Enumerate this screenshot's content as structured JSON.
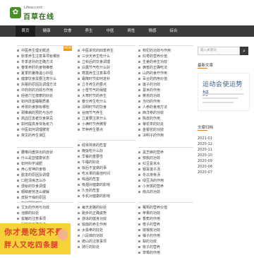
{
  "header": {
    "logo_icon": "✿",
    "logo_sub": "Lifeaccord",
    "logo_title": "百草在线"
  },
  "nav": {
    "items": [
      "首页",
      "健康",
      "饮食",
      "养生",
      "中医",
      "两性",
      "情感",
      "综合"
    ],
    "active_index": 0
  },
  "search": {
    "placeholder": "输入关键词",
    "button_icon": "search-icon"
  },
  "sidebar": {
    "section_title": "最新文章",
    "ad_text": "运动会使运势好",
    "archive_title": "文章归档",
    "archive": [
      "2021-01",
      "2020-12",
      "2020-11",
      "2020-10",
      "2020-09",
      "2020-08",
      "2020-07"
    ]
  },
  "col1": {
    "tag": "NEW",
    "items": [
      "中医养生理论概述",
      "秋季养生注意事项有哪些",
      "冬季进补的正确方法",
      "春季养肝的食物推荐",
      "夏季防暑降温小妙招",
      "健康饮食需要注意什么",
      "失眠的原因及调理方法",
      "中药材的功效与作用",
      "经络穴位按摩的好处",
      "如何改善睡眠质量",
      "养胃的食物有哪些",
      "颈椎病的预防与治疗",
      "高血压患者饮食禁忌",
      "如何提高身体免疫力",
      "中医如何调理脾胃",
      "常见的养生误区",
      "补肾的食物有哪些",
      "茶叶的保健功效",
      "喝水的正确时间",
      "运动养生的好处",
      "老年人养生保健",
      "女性养颜的方法",
      "儿童饮食健康"
    ],
    "items2": [
      "腰椎间盘突出的症状",
      "什么是亚健康状态",
      "如何科学减肥",
      "养心安神的食物",
      "脱发的原因及调理",
      "口腔溃疡怎么办",
      "便秘的饮食调理",
      "眼睛疲劳怎么缓解",
      "皮肤干燥的原因",
      "如何预防感冒"
    ],
    "items3": [
      "艾灸的作用与功效",
      "泡脚的好处",
      "拔罐的注意事项",
      "刮痧的正确方法"
    ]
  },
  "col2": {
    "items": [
      "中医讲究的四季养生",
      "三伏天养生吃什么",
      "立秋后的饮食调理",
      "白露节气吃什么好",
      "寒露养生注意事项",
      "霜降时节如何进补",
      "立冬养生的要点",
      "小雪节气的保健",
      "大寒时节的养生",
      "春分养生吃什么",
      "清明时节的饮食",
      "谷雨节气养生",
      "立夏要注意什么",
      "小满时节养脾胃",
      "芒种养生要点",
      "夏至吃什么养生",
      "小暑大暑的养生",
      "处暑养生常识",
      "秋分时节吃什么",
      "冬至进补正当时",
      "腊八粥的营养价值",
      "春节饮食健康"
    ],
    "items2": [
      "经常熬夜的危害",
      "晚饭吃什么好",
      "早餐的重要性",
      "午睡的好处",
      "饭后不宜做的事",
      "吃水果的最佳时间",
      "喝酒的危害",
      "吸烟对健康的影响",
      "久坐的危害",
      "手机对健康的影响"
    ],
    "items3": [
      "每天走路的好处",
      "跑步的正确姿势",
      "游泳的健身功效",
      "瑜伽的养生作用",
      "太极拳的好处",
      "八段锦的功效",
      "爬山的注意事项",
      "骑行的好处"
    ]
  },
  "col3": {
    "items": [
      "枸杞的功效与作用",
      "红枣的营养价值",
      "生姜的养生功效",
      "蜂蜜的正确吃法",
      "山药的食疗作用",
      "百合的药用价值",
      "莲子的功效",
      "薏米的作用",
      "黄芪的功效",
      "当归的作用",
      "人参的食用方法",
      "西洋参的功效",
      "陈皮的作用",
      "菊花茶的好处",
      "金银花的功效",
      "决明子的作用",
      "玫瑰花茶功效",
      "绿茶的保健作用"
    ],
    "items2": [
      "黑芝麻的营养",
      "核桃的功效",
      "红豆薏米水",
      "银耳莲子汤",
      "冬瓜排骨汤",
      "绿豆汤的作用",
      "小米粥的营养",
      "南瓜的功效",
      "山楂的作用",
      "木耳的营养"
    ],
    "items3": [
      "葡萄的营养价值",
      "苹果的功效",
      "香蕉的作用",
      "橙子的营养",
      "猕猴桃功效",
      "柚子的作用",
      "梨的功效",
      "桃子的营养",
      "草莓的作用"
    ]
  },
  "banner": {
    "line1": "你才是吃货不是",
    "line2": "胖人又吃四条腿"
  }
}
